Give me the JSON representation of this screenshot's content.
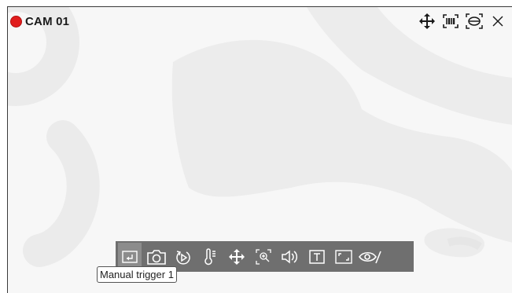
{
  "camera": {
    "name": "CAM 01",
    "recording_color": "#e11d1d"
  },
  "top_icons": [
    {
      "name": "ptz-move-icon"
    },
    {
      "name": "barcode-icon"
    },
    {
      "name": "fisheye-dewarp-icon"
    },
    {
      "name": "close-icon"
    }
  ],
  "toolbar": {
    "buttons": [
      {
        "name": "manual-trigger-icon",
        "active": true
      },
      {
        "name": "capture-icon"
      },
      {
        "name": "playback-icon"
      },
      {
        "name": "temperature-icon"
      },
      {
        "name": "ptz-icon"
      },
      {
        "name": "zoom-in-icon"
      },
      {
        "name": "audio-icon"
      },
      {
        "name": "text-overlay-icon"
      },
      {
        "name": "fullscreen-icon"
      },
      {
        "name": "privacy-mask-icon"
      }
    ]
  },
  "tooltip": {
    "text": "Manual trigger 1"
  }
}
